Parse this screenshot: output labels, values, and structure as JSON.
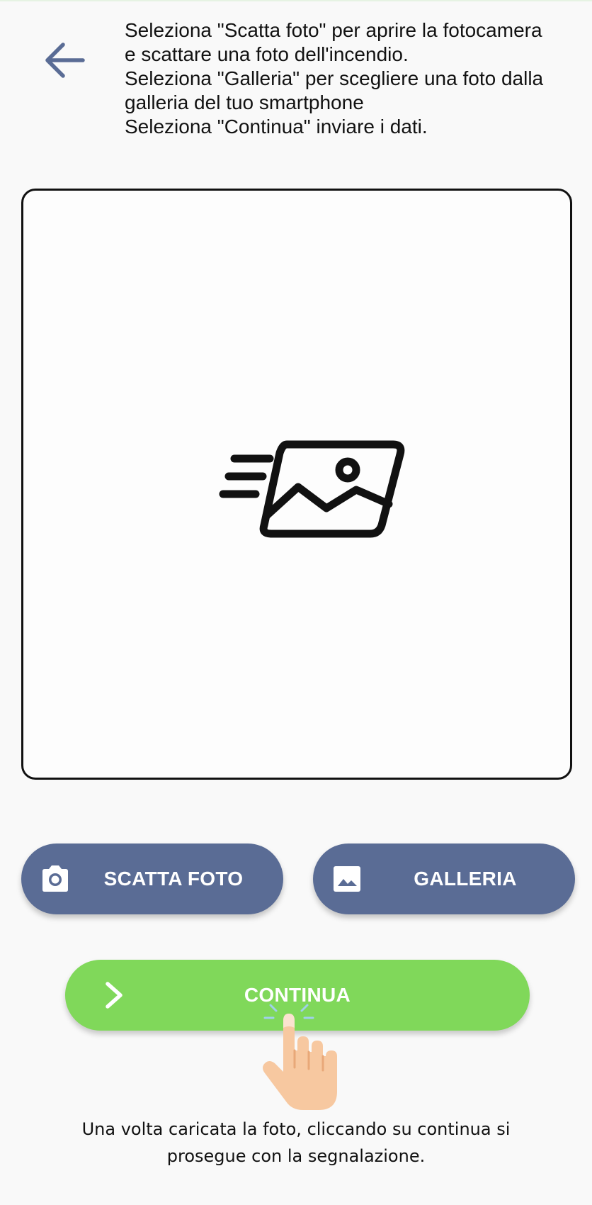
{
  "instructions": {
    "lines": [
      "Seleziona \"Scatta foto\" per aprire la fotocamera",
      "e scattare una foto dell'incendio.",
      "Seleziona \"Galleria\" per scegliere una foto dalla",
      "galleria del tuo smartphone",
      "Seleziona \"Continua\" inviare i dati."
    ]
  },
  "buttons": {
    "scatta_foto": {
      "label": "SCATTA FOTO",
      "icon": "camera-icon"
    },
    "galleria": {
      "label": "GALLERIA",
      "icon": "image-icon"
    },
    "continua": {
      "label": "CONTINUA",
      "icon": "chevron-right-icon"
    }
  },
  "preview": {
    "icon": "image-placeholder-icon"
  },
  "caption": {
    "lines": [
      "Una volta caricata la foto, cliccando su continua si",
      "prosegue con la segnalazione."
    ]
  },
  "colors": {
    "background": "#f9f9f9",
    "back_arrow": "#5a6c95",
    "button_blue": "#5a6c95",
    "button_green": "#80d85a",
    "text": "#121212"
  }
}
